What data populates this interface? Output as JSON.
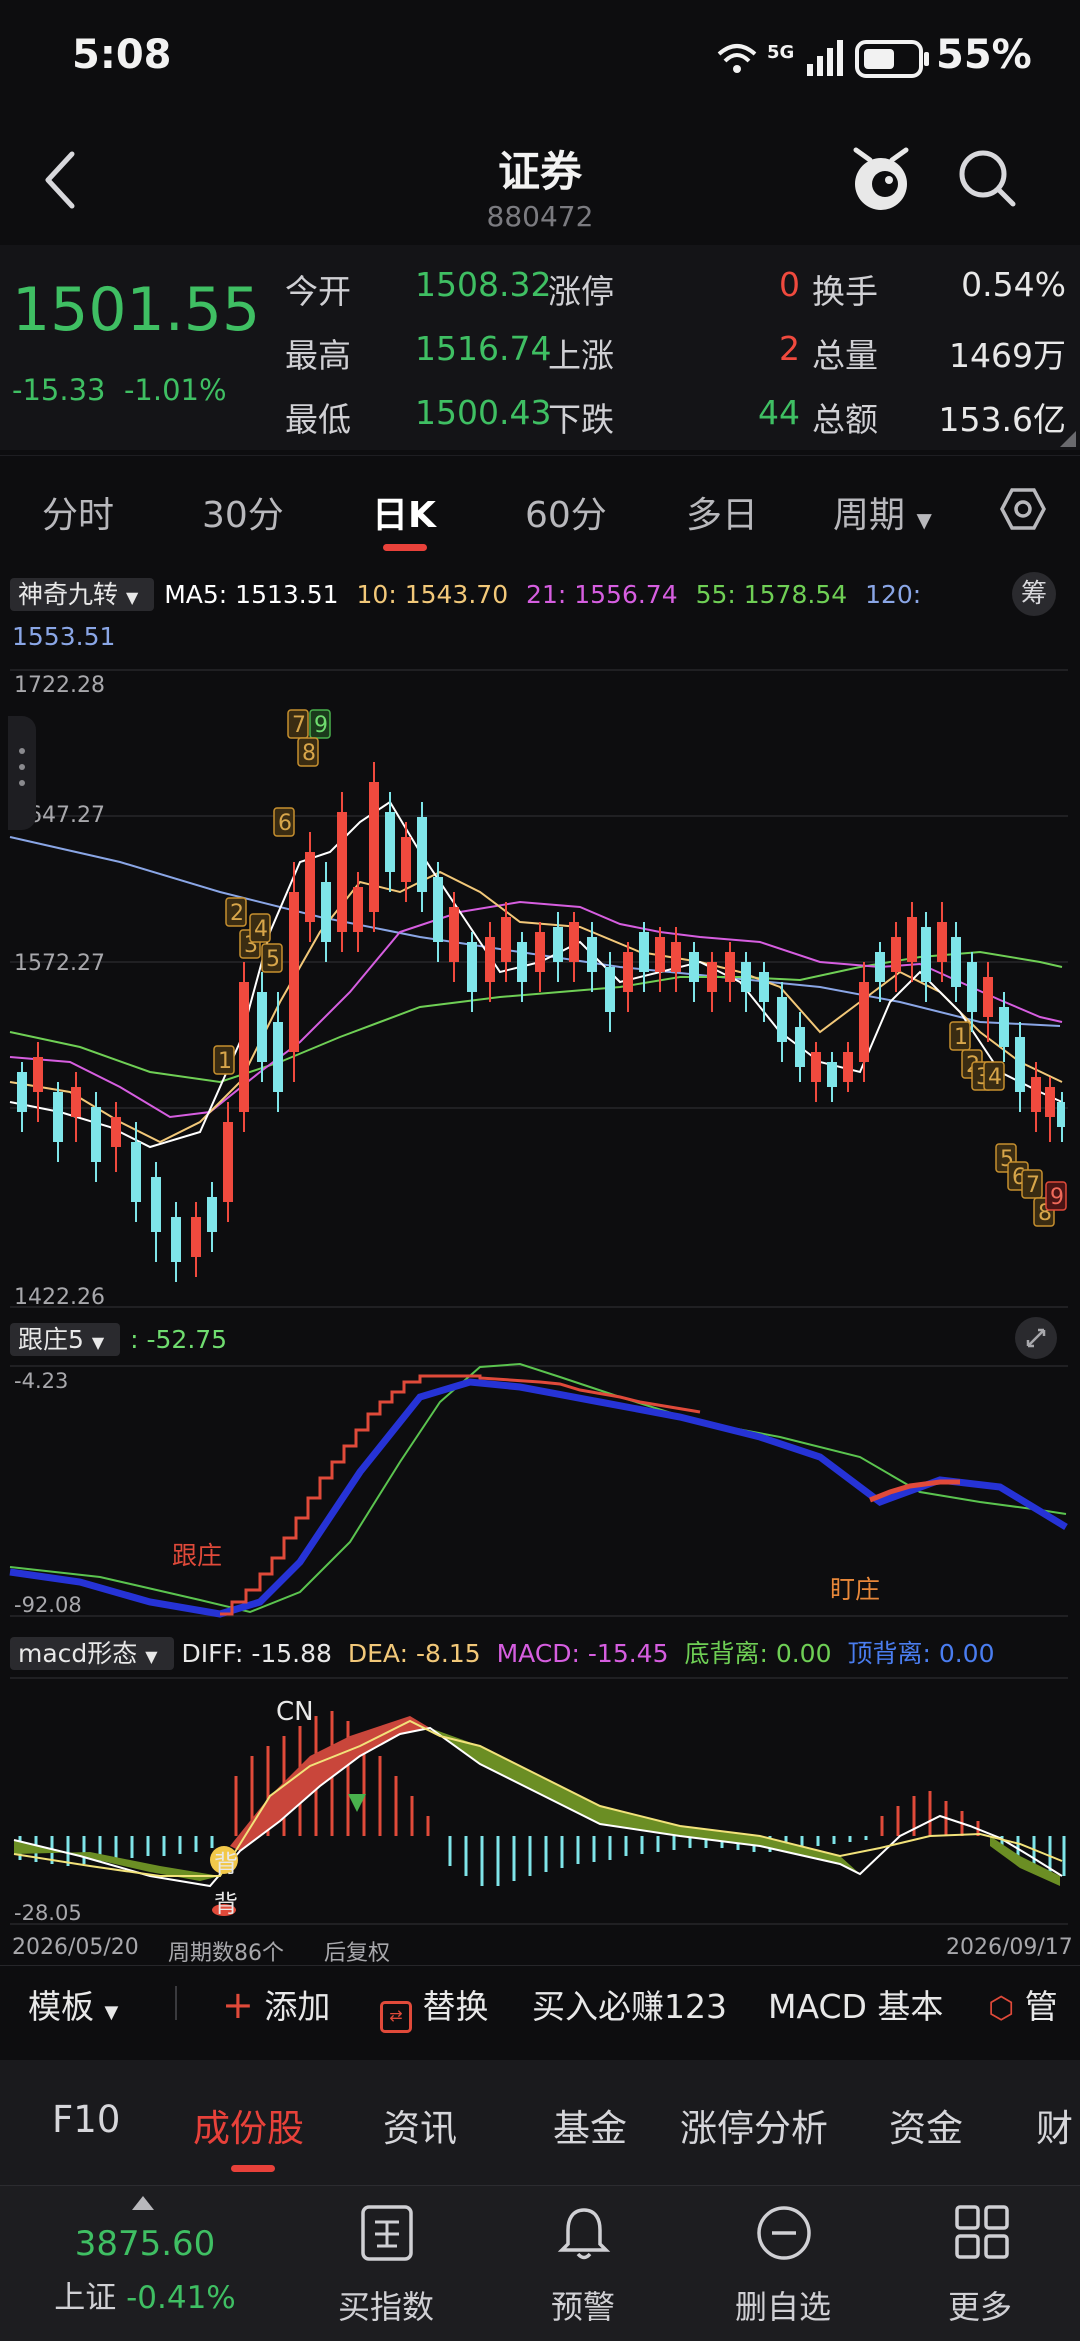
{
  "status_bar": {
    "time": "5:08",
    "network": "5G",
    "battery": "55%"
  },
  "header": {
    "title": "证券",
    "code": "880472"
  },
  "quote": {
    "price": "1501.55",
    "change": "-15.33",
    "change_pct": "-1.01%",
    "rows": [
      {
        "l1": "今开",
        "v1": "1508.32",
        "l2": "涨停",
        "n2": "0",
        "l3": "换手",
        "v3": "0.54%"
      },
      {
        "l1": "最高",
        "v1": "1516.74",
        "l2": "上涨",
        "n2": "2",
        "l3": "总量",
        "v3": "1469万"
      },
      {
        "l1": "最低",
        "v1": "1500.43",
        "l2": "下跌",
        "n2": "44",
        "l3": "总额",
        "v3": "153.6亿"
      }
    ]
  },
  "period_tabs": [
    "分时",
    "30分",
    "日K",
    "60分",
    "多日",
    "周期"
  ],
  "main_indicator": {
    "name": "神奇九转",
    "ma5": "MA5: 1513.51",
    "ma10": "10: 1543.70",
    "ma21": "21: 1556.74",
    "ma55": "55: 1578.54",
    "ma120_label": "120:",
    "ma120_value": "1553.51",
    "chip_btn": "筹",
    "y_labels": [
      "1722.28",
      "1647.27",
      "1572.27",
      "1422.26"
    ],
    "td_labels": [
      "7",
      "9",
      "8",
      "6",
      "2",
      "3",
      "4",
      "5",
      "1",
      "1",
      "2",
      "3",
      "4",
      "5",
      "6",
      "7",
      "8",
      "9"
    ]
  },
  "sub_indicator_1": {
    "name": "跟庄5",
    "value": ": -52.75",
    "y_top": "-4.23",
    "y_bottom": "-92.08",
    "label_follow": "跟庄",
    "label_watch": "盯庄"
  },
  "sub_indicator_2": {
    "name": "macd形态",
    "diff": "DIFF: -15.88",
    "dea": "DEA: -8.15",
    "macd": "MACD: -15.45",
    "bottom_div": "底背离: 0.00",
    "top_div": "顶背离: 0.00",
    "y_bottom": "-28.05",
    "cn_label": "CN",
    "mark_a": "背",
    "mark_b": "背"
  },
  "axis_footer": {
    "start_date": "2026/05/20",
    "period_count": "周期数86个",
    "adjust": "后复权",
    "end_date": "2026/09/17"
  },
  "toolbar": {
    "template": "模板",
    "add": "添加",
    "replace": "替换",
    "buy": "买入必赚123",
    "macd": "MACD 基本",
    "manage": "管"
  },
  "bottom_tabs": [
    "F10",
    "成份股",
    "资讯",
    "基金",
    "涨停分析",
    "资金",
    "财"
  ],
  "bottom_nav": {
    "index_value": "3875.60",
    "index_name": "上证",
    "index_change": "-0.41%",
    "items": [
      "买指数",
      "预警",
      "删自选",
      "更多"
    ]
  },
  "colors": {
    "up": "#f04a3e",
    "down": "#3fbf63",
    "cyan_candle": "#7fe5e9",
    "ma5": "#ffffff",
    "ma10": "#f2c879",
    "ma21": "#d65ee0",
    "ma55": "#6fcf55",
    "ma120": "#8aa6e6"
  }
}
